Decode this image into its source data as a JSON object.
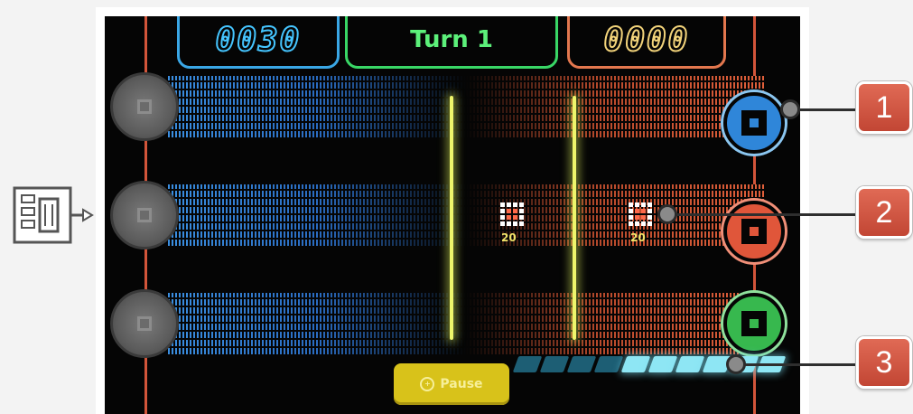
{
  "hud": {
    "left_score": "0030",
    "turn_label": "Turn 1",
    "right_score": "0000"
  },
  "tokens": [
    {
      "value": "20"
    },
    {
      "value": "20"
    }
  ],
  "pause_button": {
    "label": "Pause",
    "icon": "plus-circle-icon"
  },
  "energy_meter": {
    "segments_total": 10,
    "segments_lit": 6,
    "lit_color": "#8ee6f4",
    "unlit_color": "#1d5e74"
  },
  "callouts": [
    "1",
    "2",
    "3"
  ],
  "colors": {
    "player_left": "#3aa7e6",
    "turn_panel": "#39d766",
    "player_right": "#e3774e",
    "right_button_1": "#2f86d9",
    "right_button_2": "#e0563a",
    "right_button_3": "#37b84e",
    "beam": "#eef56b",
    "callout_badge": "#d0503d"
  },
  "icons": {
    "left_side": "circuit-chip-icon",
    "left_buttons": "gray-square-button-icon",
    "right_buttons": "square-target-icon"
  }
}
